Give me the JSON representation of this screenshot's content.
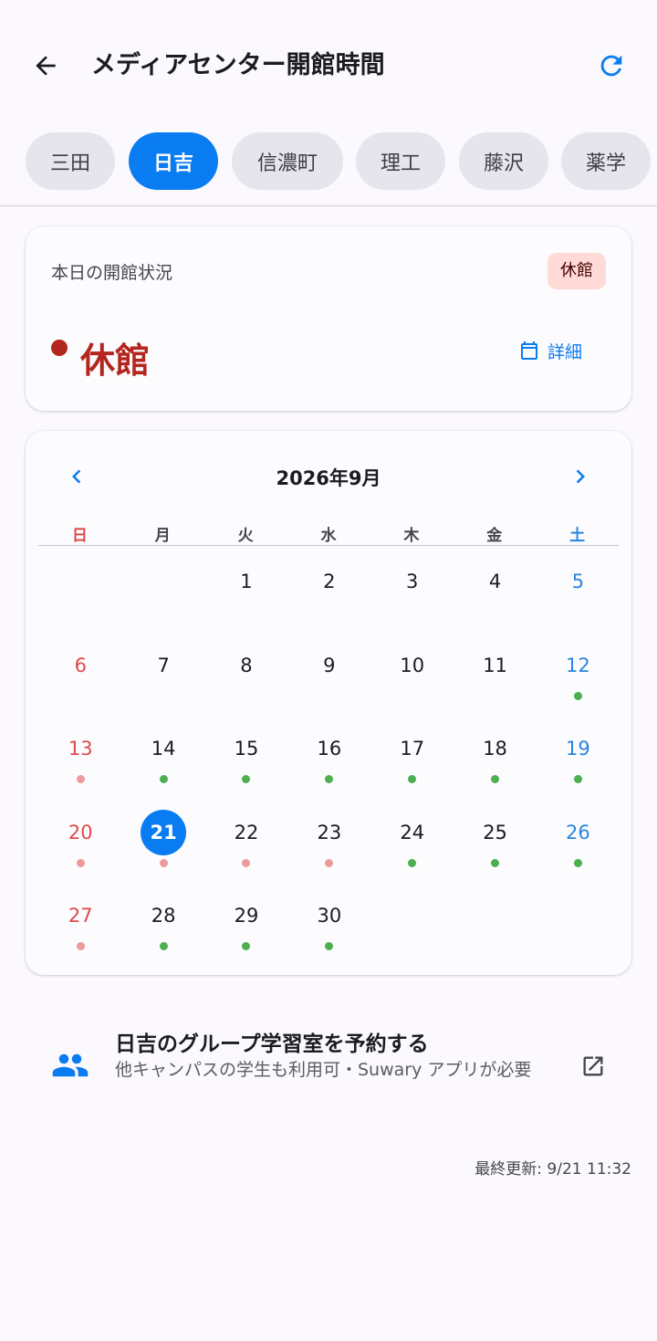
{
  "app_bar": {
    "title": "メディアセンター開館時間",
    "back_icon": "arrow-back-icon",
    "refresh_icon": "refresh-icon",
    "accent": "#0A7CF2"
  },
  "campuses": [
    {
      "label": "三田",
      "active": false
    },
    {
      "label": "日吉",
      "active": true
    },
    {
      "label": "信濃町",
      "active": false
    },
    {
      "label": "理工",
      "active": false
    },
    {
      "label": "藤沢",
      "active": false
    },
    {
      "label": "薬学",
      "active": false
    }
  ],
  "status": {
    "label": "本日の開館状況",
    "badge": "休館",
    "state": "休館",
    "state_color": "#B3261E",
    "detail_label": "詳細",
    "detail_icon": "calendar-icon"
  },
  "calendar": {
    "month_title": "2026年9月",
    "prev_icon": "chevron-left-icon",
    "next_icon": "chevron-right-icon",
    "weekdays": [
      "日",
      "月",
      "火",
      "水",
      "木",
      "金",
      "土"
    ],
    "first_weekday": 2,
    "today": 21,
    "days": [
      {
        "d": "1",
        "s": null
      },
      {
        "d": "2",
        "s": null
      },
      {
        "d": "3",
        "s": null
      },
      {
        "d": "4",
        "s": null
      },
      {
        "d": "5",
        "s": null
      },
      {
        "d": "6",
        "s": null
      },
      {
        "d": "7",
        "s": null
      },
      {
        "d": "8",
        "s": null
      },
      {
        "d": "9",
        "s": null
      },
      {
        "d": "10",
        "s": null
      },
      {
        "d": "11",
        "s": null
      },
      {
        "d": "12",
        "s": "open"
      },
      {
        "d": "13",
        "s": "closed"
      },
      {
        "d": "14",
        "s": "open"
      },
      {
        "d": "15",
        "s": "open"
      },
      {
        "d": "16",
        "s": "open"
      },
      {
        "d": "17",
        "s": "open"
      },
      {
        "d": "18",
        "s": "open"
      },
      {
        "d": "19",
        "s": "open"
      },
      {
        "d": "20",
        "s": "closed"
      },
      {
        "d": "21",
        "s": "closed"
      },
      {
        "d": "22",
        "s": "closed"
      },
      {
        "d": "23",
        "s": "closed"
      },
      {
        "d": "24",
        "s": "open"
      },
      {
        "d": "25",
        "s": "open"
      },
      {
        "d": "26",
        "s": "open"
      },
      {
        "d": "27",
        "s": "closed"
      },
      {
        "d": "28",
        "s": "open"
      },
      {
        "d": "29",
        "s": "open"
      },
      {
        "d": "30",
        "s": "open"
      }
    ],
    "colors": {
      "open_dot": "#4CAF50",
      "closed_dot": "#EF9A9A",
      "sunday": "#E04A4A",
      "saturday": "#2A86E0"
    }
  },
  "booking": {
    "title": "日吉のグループ学習室を予約する",
    "subtitle": "他キャンパスの学生も利用可・Suwary アプリが必要",
    "icon": "group-icon",
    "action_icon": "open-in-new-icon"
  },
  "footer": {
    "last_updated": "最終更新: 9/21 11:32"
  }
}
